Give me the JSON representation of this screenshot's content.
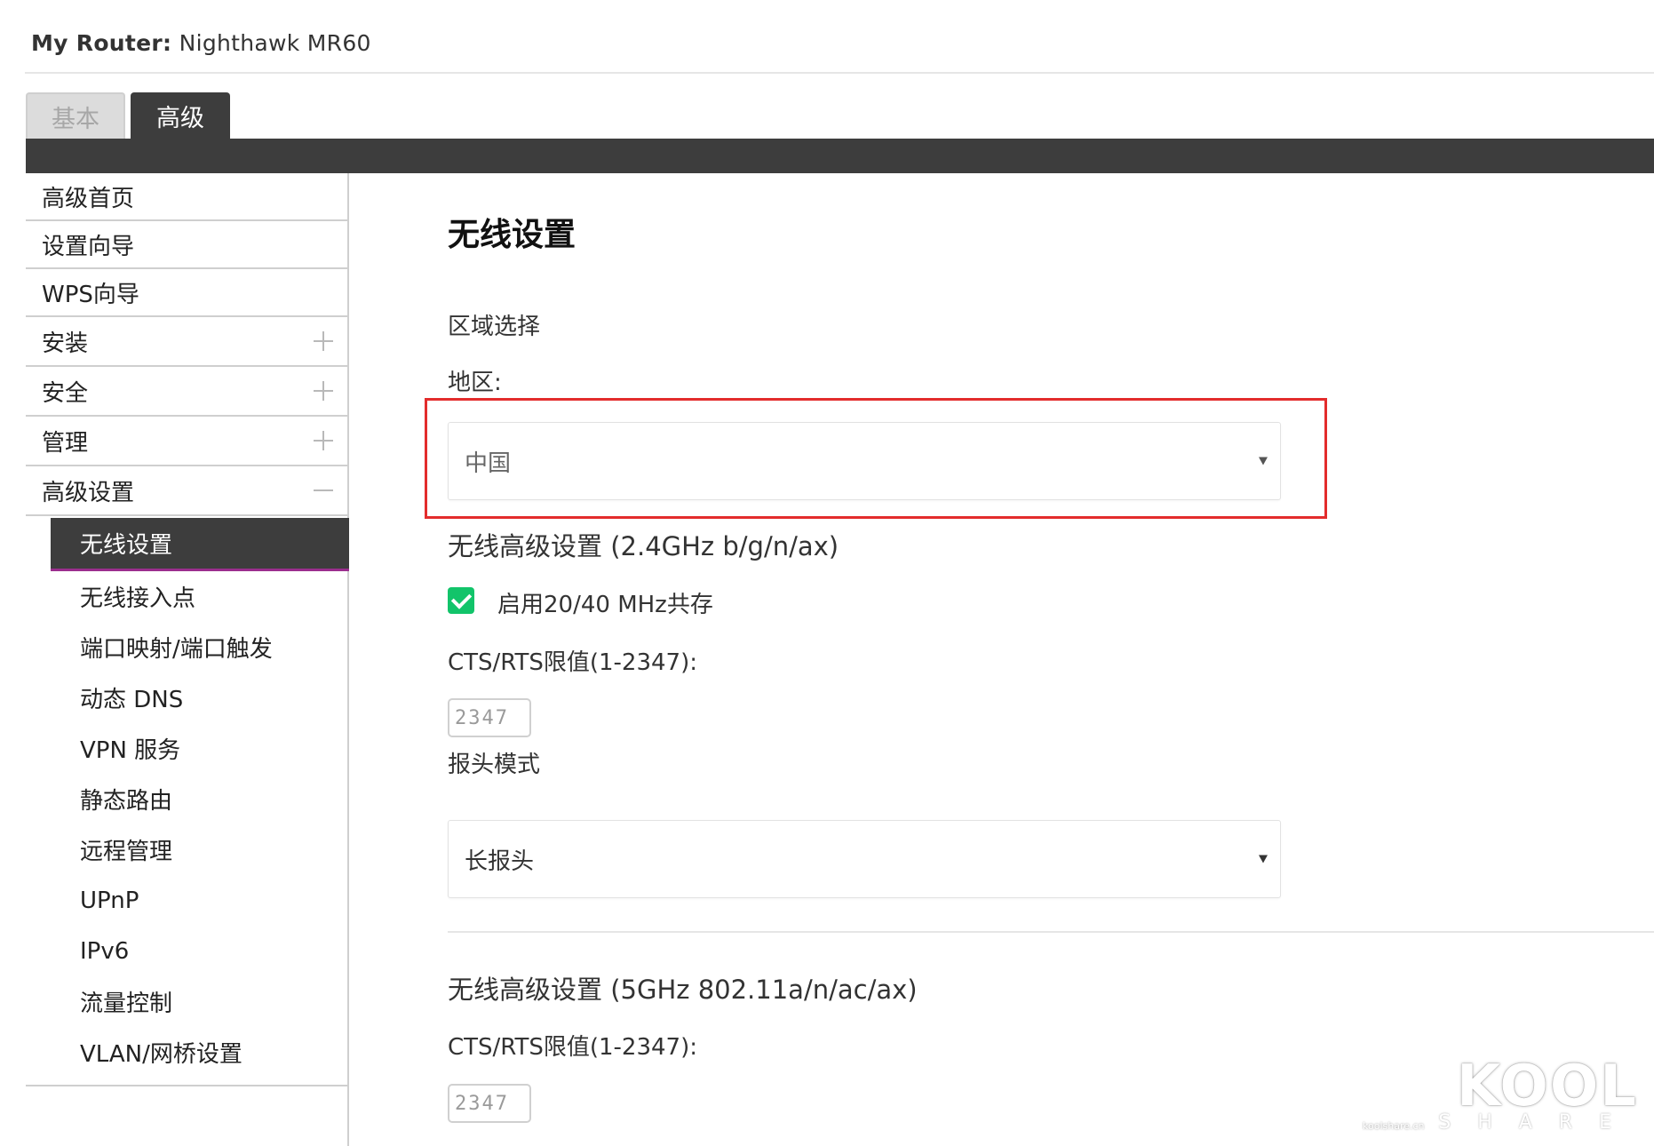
{
  "header": {
    "label": "My Router:",
    "model": "Nighthawk MR60"
  },
  "tabs": [
    {
      "label": "基本",
      "active": false
    },
    {
      "label": "高级",
      "active": true
    }
  ],
  "sidebar": {
    "items": [
      {
        "label": "高级首页"
      },
      {
        "label": "设置向导"
      },
      {
        "label": "WPS向导"
      },
      {
        "label": "安装",
        "expander": "plus"
      },
      {
        "label": "安全",
        "expander": "plus"
      },
      {
        "label": "管理",
        "expander": "plus"
      },
      {
        "label": "高级设置",
        "expander": "minus"
      }
    ],
    "subitems": [
      {
        "label": "无线设置",
        "active": true
      },
      {
        "label": "无线接入点"
      },
      {
        "label": "端口映射/端口触发"
      },
      {
        "label": "动态 DNS"
      },
      {
        "label": "VPN 服务"
      },
      {
        "label": "静态路由"
      },
      {
        "label": "远程管理"
      },
      {
        "label": "UPnP"
      },
      {
        "label": "IPv6"
      },
      {
        "label": "流量控制"
      },
      {
        "label": "VLAN/网桥设置"
      }
    ]
  },
  "main": {
    "title": "无线设置",
    "region_section": "区域选择",
    "region_label": "地区:",
    "region_value": "中国",
    "band24_heading": "无线高级设置 (2.4GHz b/g/n/ax)",
    "coexist_label": "启用20/40 MHz共存",
    "coexist_checked": true,
    "cts_label": "CTS/RTS限值(1-2347):",
    "cts_value_24": "2347",
    "preamble_label": "报头模式",
    "preamble_value": "长报头",
    "band5_heading": "无线高级设置 (5GHz 802.11a/n/ac/ax)",
    "cts_label_5": "CTS/RTS限值(1-2347):",
    "cts_value_5": "2347"
  },
  "colors": {
    "dark_bar": "#3d3d3d",
    "active_underline": "#9b2e8e",
    "checkbox": "#12c46a",
    "highlight_frame": "#e32c2c"
  },
  "watermark": {
    "main": "KOOL",
    "sub": "SHARE",
    "small": "koolshare.cn"
  }
}
